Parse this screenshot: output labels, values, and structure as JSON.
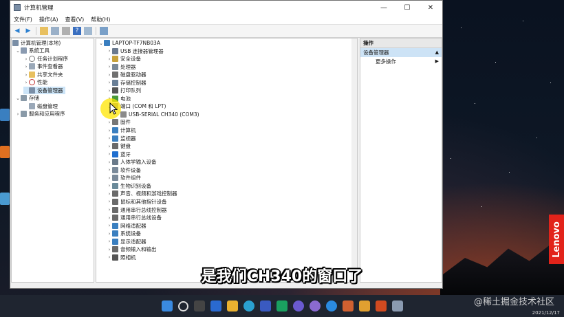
{
  "window": {
    "title": "计算机管理",
    "controls": {
      "minimize": "—",
      "maximize": "☐",
      "close": "✕"
    }
  },
  "menu": [
    "文件(F)",
    "操作(A)",
    "查看(V)",
    "帮助(H)"
  ],
  "left_tree": [
    {
      "label": "计算机管理(本地)",
      "level": 0,
      "exp": ""
    },
    {
      "label": "系统工具",
      "level": 1,
      "exp": "⌄"
    },
    {
      "label": "任务计划程序",
      "level": 2,
      "exp": "›"
    },
    {
      "label": "事件查看器",
      "level": 2,
      "exp": "›"
    },
    {
      "label": "共享文件夹",
      "level": 2,
      "exp": "›"
    },
    {
      "label": "性能",
      "level": 2,
      "exp": "›"
    },
    {
      "label": "设备管理器",
      "level": 2,
      "exp": "",
      "selected": true
    },
    {
      "label": "存储",
      "level": 1,
      "exp": "⌄"
    },
    {
      "label": "磁盘管理",
      "level": 2,
      "exp": ""
    },
    {
      "label": "服务和应用程序",
      "level": 1,
      "exp": "›"
    }
  ],
  "device_tree": {
    "root": "LAPTOP-TF7NB03A",
    "items": [
      {
        "label": "USB 连接器管理器",
        "exp": "›",
        "color": "#6b7a8f"
      },
      {
        "label": "安全设备",
        "exp": "›",
        "color": "#c8a23c"
      },
      {
        "label": "处理器",
        "exp": "›",
        "color": "#7a8a99"
      },
      {
        "label": "磁盘驱动器",
        "exp": "›",
        "color": "#707070"
      },
      {
        "label": "存储控制器",
        "exp": "›",
        "color": "#6a7f96"
      },
      {
        "label": "打印队列",
        "exp": "›",
        "color": "#555"
      },
      {
        "label": "电池",
        "exp": "›",
        "color": "#4a9a3a"
      },
      {
        "label": "端口 (COM 和 LPT)",
        "exp": "⌄",
        "color": "#8a8a8a"
      },
      {
        "label": "USB-SERIAL CH340 (COM3)",
        "exp": "",
        "indent": true,
        "color": "#8a8a8a"
      },
      {
        "label": "固件",
        "exp": "›",
        "color": "#777"
      },
      {
        "label": "计算机",
        "exp": "›",
        "color": "#3a7fc0"
      },
      {
        "label": "监视器",
        "exp": "›",
        "color": "#3a7fc0"
      },
      {
        "label": "键盘",
        "exp": "›",
        "color": "#6a6a6a"
      },
      {
        "label": "蓝牙",
        "exp": "›",
        "color": "#1f6fd0"
      },
      {
        "label": "人体学输入设备",
        "exp": "›",
        "color": "#6a7a8a"
      },
      {
        "label": "软件设备",
        "exp": "›",
        "color": "#7a8a9a"
      },
      {
        "label": "软件组件",
        "exp": "›",
        "color": "#7a8a9a"
      },
      {
        "label": "生物识别设备",
        "exp": "›",
        "color": "#6a8a9a"
      },
      {
        "label": "声音、视频和游戏控制器",
        "exp": "›",
        "color": "#6a6a6a"
      },
      {
        "label": "鼠标和其他指针设备",
        "exp": "›",
        "color": "#6a6a6a"
      },
      {
        "label": "通用串行总线控制器",
        "exp": "›",
        "color": "#6a6a6a"
      },
      {
        "label": "通用串行总线设备",
        "exp": "›",
        "color": "#6a6a6a"
      },
      {
        "label": "网络适配器",
        "exp": "›",
        "color": "#3a7fc0"
      },
      {
        "label": "系统设备",
        "exp": "›",
        "color": "#3a7fc0"
      },
      {
        "label": "显示适配器",
        "exp": "›",
        "color": "#3a7fc0"
      },
      {
        "label": "音频输入和输出",
        "exp": "›",
        "color": "#6a6a6a"
      },
      {
        "label": "照相机",
        "exp": "›",
        "color": "#555"
      }
    ]
  },
  "actions": {
    "header": "操作",
    "selected": "设备管理器",
    "more": "更多操作"
  },
  "subtitle": "是我们CH340的窗口了",
  "watermark": "@稀土掘金技术社区",
  "clock": {
    "date": "2021/12/17"
  },
  "brand": "Lenovo"
}
